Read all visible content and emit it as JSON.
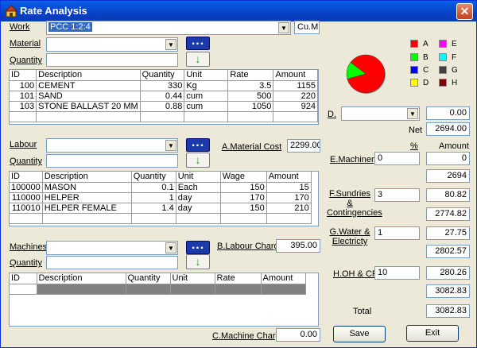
{
  "window": {
    "title": "Rate Analysis",
    "close": "✕"
  },
  "work": {
    "label": "Work",
    "value": "PCC 1:2:4",
    "unit": "Cu.M."
  },
  "material": {
    "label": "Material",
    "quantity_label": "Quantity",
    "columns": [
      "ID",
      "Description",
      "Quantity",
      "Unit",
      "Rate",
      "Amount"
    ],
    "rows": [
      [
        "100",
        "CEMENT",
        "330",
        "Kg",
        "3.5",
        "1155"
      ],
      [
        "101",
        "SAND",
        "0.44",
        "cum",
        "500",
        "220"
      ],
      [
        "103",
        "STONE BALLAST 20 MM",
        "0.88",
        "cum",
        "1050",
        "924"
      ]
    ]
  },
  "labour": {
    "label": "Labour",
    "quantity_label": "Quantity",
    "columns": [
      "ID",
      "Description",
      "Quantity",
      "Unit",
      "Wage",
      "Amount"
    ],
    "rows": [
      [
        "100000",
        "MASON",
        "0.1",
        "Each",
        "150",
        "15"
      ],
      [
        "110000",
        "HELPER",
        "1",
        "day",
        "170",
        "170"
      ],
      [
        "110010",
        "HELPER FEMALE",
        "1.4",
        "day",
        "150",
        "210"
      ]
    ]
  },
  "machines": {
    "label": "Machines",
    "quantity_label": "Quantity",
    "columns": [
      "ID",
      "Description",
      "Quantity",
      "Unit",
      "Rate",
      "Amount"
    ]
  },
  "charges": {
    "material_label": "A.Material Cost",
    "material_value": "2299.00",
    "labour_label": "B.Labour Charge",
    "labour_value": "395.00",
    "machine_label": "C.Machine Charge",
    "machine_value": "0.00"
  },
  "legend": [
    {
      "key": "A",
      "color": "#ff0000"
    },
    {
      "key": "B",
      "color": "#00ff00"
    },
    {
      "key": "C",
      "color": "#0000ff"
    },
    {
      "key": "D",
      "color": "#ffff00"
    },
    {
      "key": "E",
      "color": "#ff00ff"
    },
    {
      "key": "F",
      "color": "#00ffff"
    },
    {
      "key": "G",
      "color": "#404040"
    },
    {
      "key": "H",
      "color": "#800000"
    }
  ],
  "summary": {
    "d_label": "D.",
    "d_value": "0.00",
    "net_label": "Net",
    "net_value": "2694.00",
    "pct_header": "%",
    "amount_header": "Amount",
    "e_label": "E.Machinery",
    "e_pct": "0",
    "e_amount": "0",
    "e_total": "2694",
    "f_label": "F.Sundries & Contingencies",
    "f_pct": "3",
    "f_amount": "80.82",
    "f_total": "2774.82",
    "g_label": "G.Water & Electricty",
    "g_pct": "1",
    "g_amount": "27.75",
    "g_total": "2802.57",
    "h_label": "H.OH & CP",
    "h_pct": "10",
    "h_amount": "280.26",
    "h_total": "3082.83",
    "total_label": "Total",
    "total_value": "3082.83"
  },
  "buttons": {
    "save": "Save",
    "exit": "Exit"
  },
  "chart_data": {
    "type": "pie",
    "categories": [
      "A",
      "B",
      "C",
      "D",
      "E",
      "F",
      "G",
      "H"
    ],
    "values": [
      2299,
      395,
      0,
      0,
      0,
      0,
      0,
      0
    ]
  }
}
